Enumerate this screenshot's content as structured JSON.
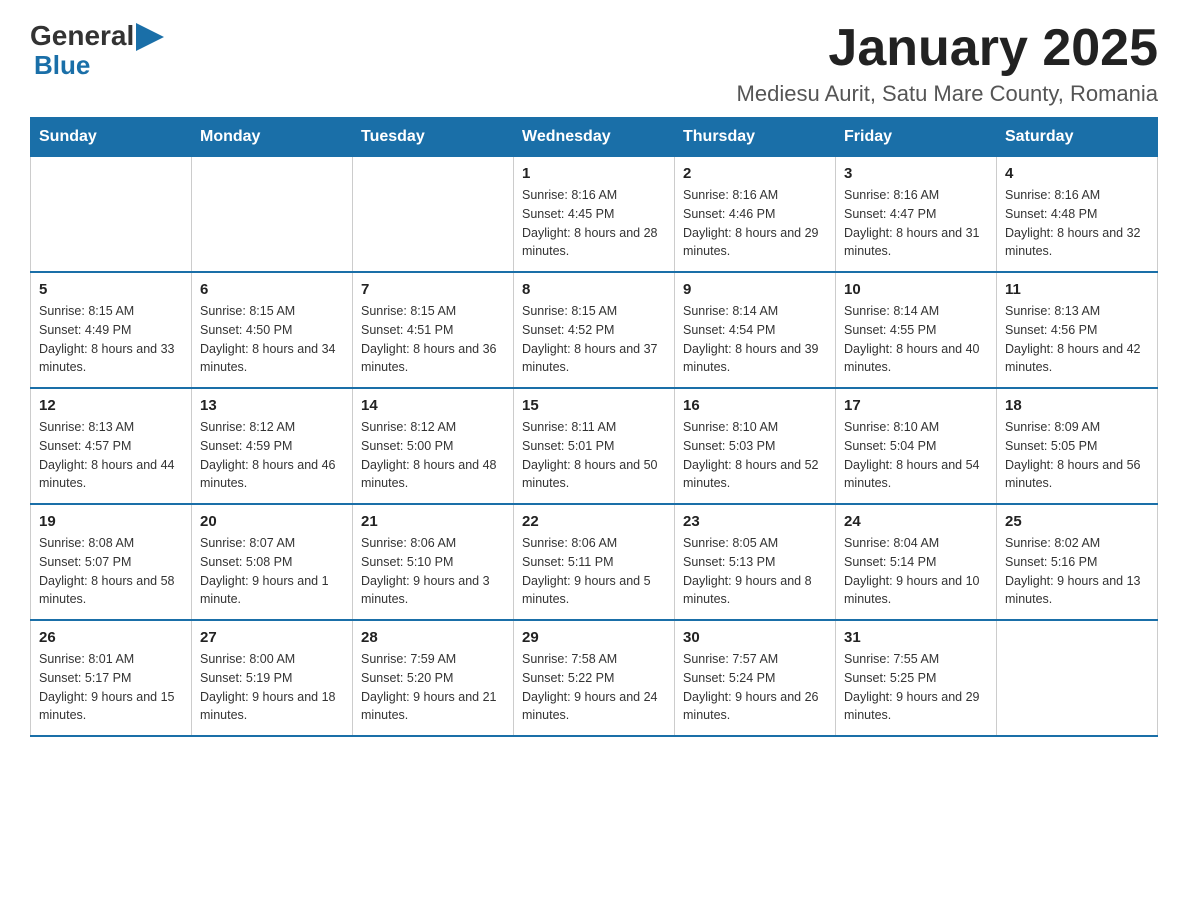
{
  "header": {
    "logo": {
      "general": "General",
      "blue": "Blue",
      "aria": "GeneralBlue logo"
    },
    "title": "January 2025",
    "subtitle": "Mediesu Aurit, Satu Mare County, Romania"
  },
  "weekdays": [
    "Sunday",
    "Monday",
    "Tuesday",
    "Wednesday",
    "Thursday",
    "Friday",
    "Saturday"
  ],
  "weeks": [
    [
      {
        "day": "",
        "sunrise": "",
        "sunset": "",
        "daylight": ""
      },
      {
        "day": "",
        "sunrise": "",
        "sunset": "",
        "daylight": ""
      },
      {
        "day": "",
        "sunrise": "",
        "sunset": "",
        "daylight": ""
      },
      {
        "day": "1",
        "sunrise": "Sunrise: 8:16 AM",
        "sunset": "Sunset: 4:45 PM",
        "daylight": "Daylight: 8 hours and 28 minutes."
      },
      {
        "day": "2",
        "sunrise": "Sunrise: 8:16 AM",
        "sunset": "Sunset: 4:46 PM",
        "daylight": "Daylight: 8 hours and 29 minutes."
      },
      {
        "day": "3",
        "sunrise": "Sunrise: 8:16 AM",
        "sunset": "Sunset: 4:47 PM",
        "daylight": "Daylight: 8 hours and 31 minutes."
      },
      {
        "day": "4",
        "sunrise": "Sunrise: 8:16 AM",
        "sunset": "Sunset: 4:48 PM",
        "daylight": "Daylight: 8 hours and 32 minutes."
      }
    ],
    [
      {
        "day": "5",
        "sunrise": "Sunrise: 8:15 AM",
        "sunset": "Sunset: 4:49 PM",
        "daylight": "Daylight: 8 hours and 33 minutes."
      },
      {
        "day": "6",
        "sunrise": "Sunrise: 8:15 AM",
        "sunset": "Sunset: 4:50 PM",
        "daylight": "Daylight: 8 hours and 34 minutes."
      },
      {
        "day": "7",
        "sunrise": "Sunrise: 8:15 AM",
        "sunset": "Sunset: 4:51 PM",
        "daylight": "Daylight: 8 hours and 36 minutes."
      },
      {
        "day": "8",
        "sunrise": "Sunrise: 8:15 AM",
        "sunset": "Sunset: 4:52 PM",
        "daylight": "Daylight: 8 hours and 37 minutes."
      },
      {
        "day": "9",
        "sunrise": "Sunrise: 8:14 AM",
        "sunset": "Sunset: 4:54 PM",
        "daylight": "Daylight: 8 hours and 39 minutes."
      },
      {
        "day": "10",
        "sunrise": "Sunrise: 8:14 AM",
        "sunset": "Sunset: 4:55 PM",
        "daylight": "Daylight: 8 hours and 40 minutes."
      },
      {
        "day": "11",
        "sunrise": "Sunrise: 8:13 AM",
        "sunset": "Sunset: 4:56 PM",
        "daylight": "Daylight: 8 hours and 42 minutes."
      }
    ],
    [
      {
        "day": "12",
        "sunrise": "Sunrise: 8:13 AM",
        "sunset": "Sunset: 4:57 PM",
        "daylight": "Daylight: 8 hours and 44 minutes."
      },
      {
        "day": "13",
        "sunrise": "Sunrise: 8:12 AM",
        "sunset": "Sunset: 4:59 PM",
        "daylight": "Daylight: 8 hours and 46 minutes."
      },
      {
        "day": "14",
        "sunrise": "Sunrise: 8:12 AM",
        "sunset": "Sunset: 5:00 PM",
        "daylight": "Daylight: 8 hours and 48 minutes."
      },
      {
        "day": "15",
        "sunrise": "Sunrise: 8:11 AM",
        "sunset": "Sunset: 5:01 PM",
        "daylight": "Daylight: 8 hours and 50 minutes."
      },
      {
        "day": "16",
        "sunrise": "Sunrise: 8:10 AM",
        "sunset": "Sunset: 5:03 PM",
        "daylight": "Daylight: 8 hours and 52 minutes."
      },
      {
        "day": "17",
        "sunrise": "Sunrise: 8:10 AM",
        "sunset": "Sunset: 5:04 PM",
        "daylight": "Daylight: 8 hours and 54 minutes."
      },
      {
        "day": "18",
        "sunrise": "Sunrise: 8:09 AM",
        "sunset": "Sunset: 5:05 PM",
        "daylight": "Daylight: 8 hours and 56 minutes."
      }
    ],
    [
      {
        "day": "19",
        "sunrise": "Sunrise: 8:08 AM",
        "sunset": "Sunset: 5:07 PM",
        "daylight": "Daylight: 8 hours and 58 minutes."
      },
      {
        "day": "20",
        "sunrise": "Sunrise: 8:07 AM",
        "sunset": "Sunset: 5:08 PM",
        "daylight": "Daylight: 9 hours and 1 minute."
      },
      {
        "day": "21",
        "sunrise": "Sunrise: 8:06 AM",
        "sunset": "Sunset: 5:10 PM",
        "daylight": "Daylight: 9 hours and 3 minutes."
      },
      {
        "day": "22",
        "sunrise": "Sunrise: 8:06 AM",
        "sunset": "Sunset: 5:11 PM",
        "daylight": "Daylight: 9 hours and 5 minutes."
      },
      {
        "day": "23",
        "sunrise": "Sunrise: 8:05 AM",
        "sunset": "Sunset: 5:13 PM",
        "daylight": "Daylight: 9 hours and 8 minutes."
      },
      {
        "day": "24",
        "sunrise": "Sunrise: 8:04 AM",
        "sunset": "Sunset: 5:14 PM",
        "daylight": "Daylight: 9 hours and 10 minutes."
      },
      {
        "day": "25",
        "sunrise": "Sunrise: 8:02 AM",
        "sunset": "Sunset: 5:16 PM",
        "daylight": "Daylight: 9 hours and 13 minutes."
      }
    ],
    [
      {
        "day": "26",
        "sunrise": "Sunrise: 8:01 AM",
        "sunset": "Sunset: 5:17 PM",
        "daylight": "Daylight: 9 hours and 15 minutes."
      },
      {
        "day": "27",
        "sunrise": "Sunrise: 8:00 AM",
        "sunset": "Sunset: 5:19 PM",
        "daylight": "Daylight: 9 hours and 18 minutes."
      },
      {
        "day": "28",
        "sunrise": "Sunrise: 7:59 AM",
        "sunset": "Sunset: 5:20 PM",
        "daylight": "Daylight: 9 hours and 21 minutes."
      },
      {
        "day": "29",
        "sunrise": "Sunrise: 7:58 AM",
        "sunset": "Sunset: 5:22 PM",
        "daylight": "Daylight: 9 hours and 24 minutes."
      },
      {
        "day": "30",
        "sunrise": "Sunrise: 7:57 AM",
        "sunset": "Sunset: 5:24 PM",
        "daylight": "Daylight: 9 hours and 26 minutes."
      },
      {
        "day": "31",
        "sunrise": "Sunrise: 7:55 AM",
        "sunset": "Sunset: 5:25 PM",
        "daylight": "Daylight: 9 hours and 29 minutes."
      },
      {
        "day": "",
        "sunrise": "",
        "sunset": "",
        "daylight": ""
      }
    ]
  ]
}
